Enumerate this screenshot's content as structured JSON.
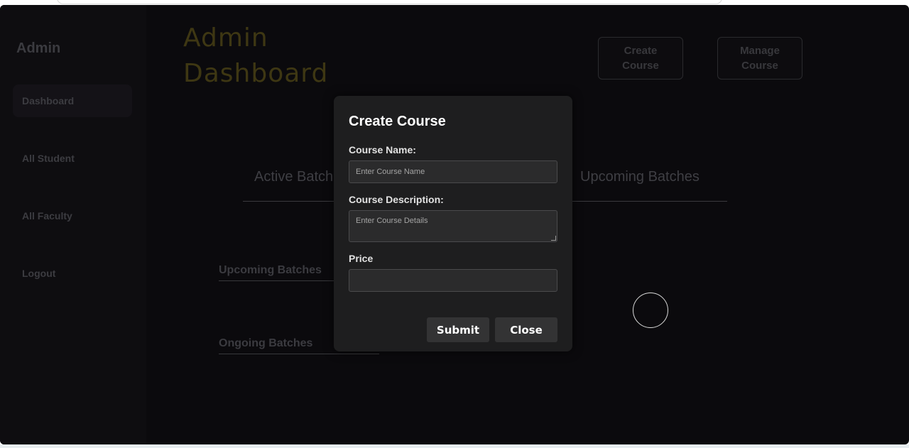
{
  "sidebar": {
    "title": "Admin",
    "items": [
      {
        "label": "Dashboard"
      },
      {
        "label": "All Student"
      },
      {
        "label": "All Faculty"
      },
      {
        "label": "Logout"
      }
    ]
  },
  "header": {
    "title_line1": "Admin",
    "title_line2": "Dashboard",
    "create_course_label": "Create Course",
    "manage_course_label": "Manage Course"
  },
  "tabs": {
    "active": "Active Batch",
    "upcoming": "Upcoming Batches"
  },
  "sections": {
    "upcoming": "Upcoming Batches",
    "ongoing": "Ongoing Batches"
  },
  "modal": {
    "title": "Create Course",
    "course_name_label": "Course Name:",
    "course_name_placeholder": "Enter Course Name",
    "course_name_value": "",
    "course_description_label": "Course Description:",
    "course_description_placeholder": "Enter Course Details",
    "course_description_value": "",
    "price_label": "Price",
    "price_value": "",
    "submit_label": "Submit",
    "close_label": "Close"
  },
  "colors": {
    "background": "#0b0a0d",
    "modal_background": "#1e1e1f",
    "title_accent": "#3e3713",
    "button_background": "#333334"
  }
}
